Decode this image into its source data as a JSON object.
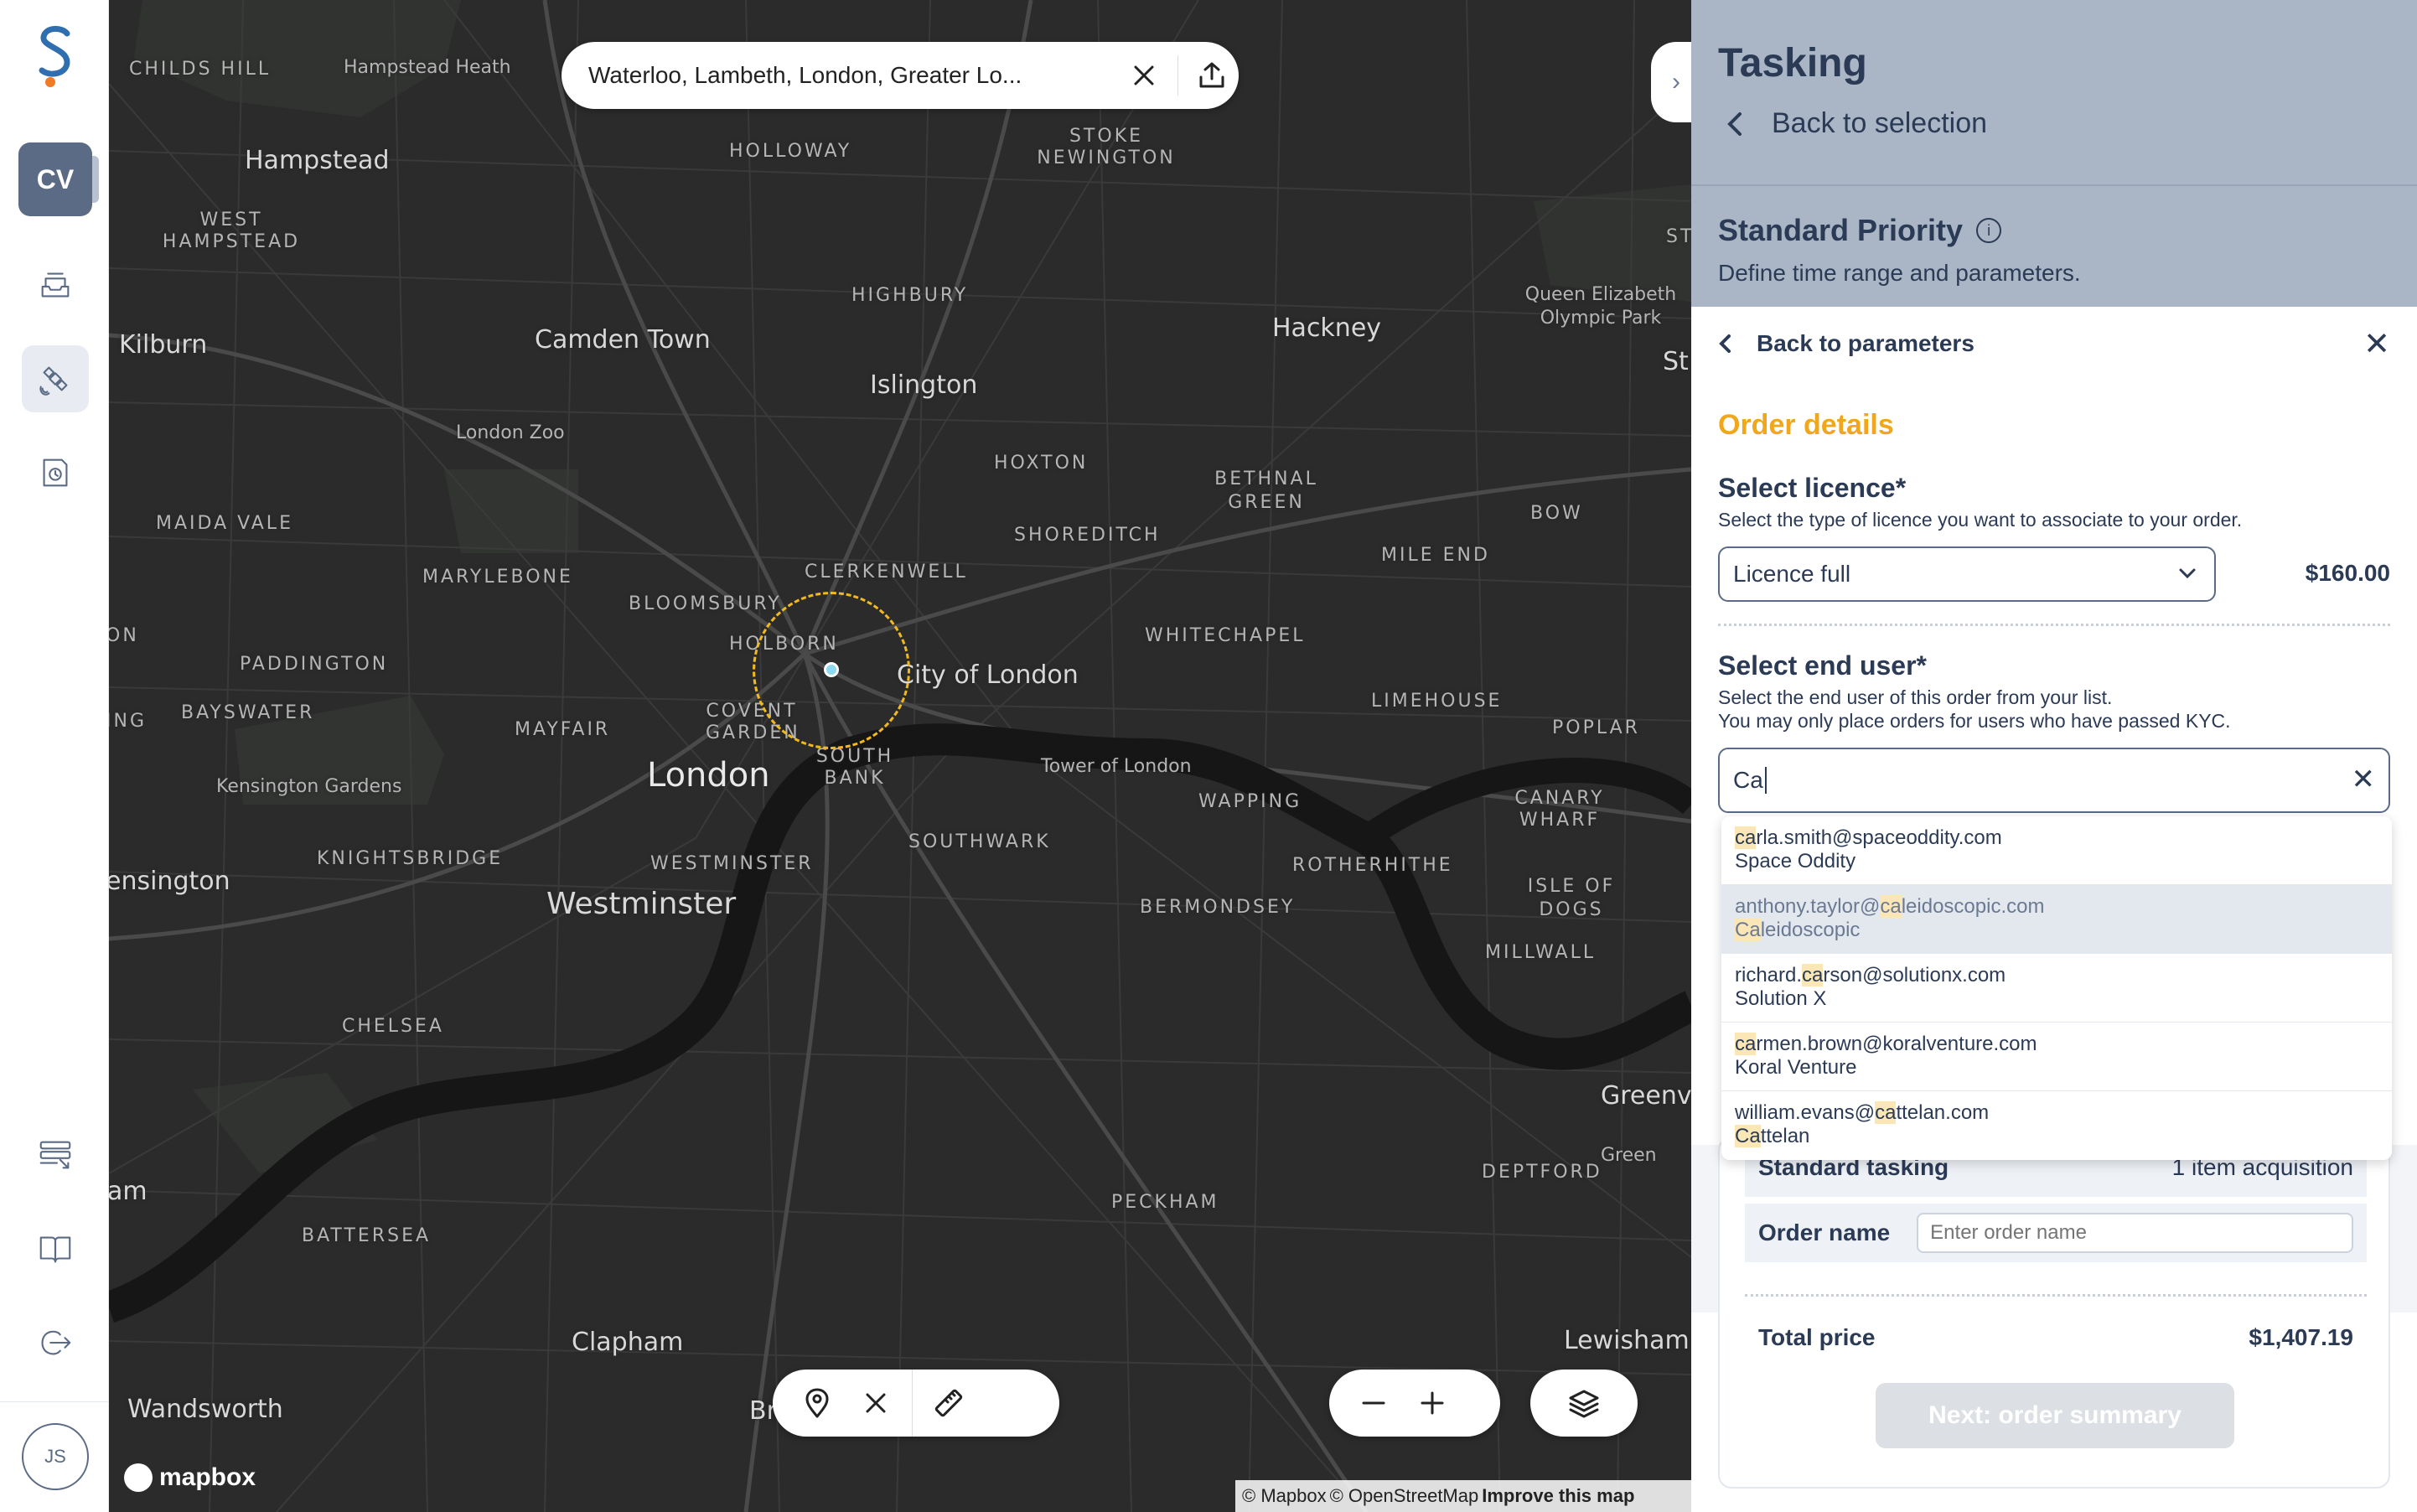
{
  "rail": {
    "avatar_initials": "CV",
    "user_initials": "JS",
    "icons": [
      "logo-icon",
      "inbox-icon",
      "satellite-icon",
      "orders-icon",
      "list-icon",
      "book-icon",
      "logout-icon"
    ]
  },
  "map": {
    "search_value": "Waterloo, Lambeth, London, Greater Lo...",
    "attribution": {
      "mapbox": "© Mapbox",
      "osm": "© OpenStreetMap",
      "improve": "Improve this map"
    },
    "logo_text": "mapbox",
    "places": {
      "childs_hill": "CHILDS HILL",
      "hampstead_heath": "Hampstead Heath",
      "hampstead": "Hampstead",
      "west_hampstead": "WEST HAMPSTEAD",
      "holloway": "HOLLOWAY",
      "stoke_newington": "STOKE NEWINGTON",
      "highbury": "HIGHBURY",
      "kilburn": "Kilburn",
      "camden_town": "Camden Town",
      "islington": "Islington",
      "hackney": "Hackney",
      "queen_elizabeth": "Queen Elizabeth Olympic Park",
      "london_zoo": "London Zoo",
      "maida_vale": "MAIDA VALE",
      "hoxton": "HOXTON",
      "bethnal_green": "BETHNAL GREEN",
      "bow": "BOW",
      "marylebone": "MARYLEBONE",
      "shoreditch": "SHOREDITCH",
      "mile_end": "MILE END",
      "clerkenwell": "CLERKENWELL",
      "bloomsbury": "BLOOMSBURY",
      "holborn": "HOLBORN",
      "paddington": "PADDINGTON",
      "city_of_london": "City of London",
      "whitechapel": "WHITECHAPEL",
      "bayswater": "BAYSWATER",
      "mayfair": "MAYFAIR",
      "covent_garden": "COVENT GARDEN",
      "limehouse": "LIMEHOUSE",
      "poplar": "POPLAR",
      "kensington_gardens": "Kensington Gardens",
      "london": "London",
      "south_bank": "SOUTH BANK",
      "tower_of_london": "Tower of London",
      "wapping": "WAPPING",
      "canary_wharf": "CANARY WHARF",
      "knightsbridge": "KNIGHTSBRIDGE",
      "westminster_area": "WESTMINSTER",
      "southwark": "SOUTHWARK",
      "rotherhithe": "ROTHERHITHE",
      "kensington": "ensington",
      "westminster": "Westminster",
      "bermondsey": "BERMONDSEY",
      "isle_of_dogs": "ISLE OF DOGS",
      "millwall": "MILLWALL",
      "chelsea": "CHELSEA",
      "battersea": "BATTERSEA",
      "peckham": "PECKHAM",
      "deptford": "DEPTFORD",
      "clapham": "Clapham",
      "lewisham": "Lewisham",
      "wandsworth": "Wandsworth",
      "brixton_partial": "Br",
      "greenwich_partial": "Greenv",
      "greenwich_small": "Green",
      "ham_partial": "am",
      "ing_partial": "ING",
      "on_partial": "ON",
      "st_partial": "St",
      "st_small": "ST"
    }
  },
  "panel": {
    "title": "Tasking",
    "back_to_selection": "Back to selection",
    "priority_title": "Standard Priority",
    "priority_subtitle": "Define time range and parameters.",
    "back_to_parameters": "Back to parameters",
    "order_details": "Order details",
    "licence_label": "Select licence*",
    "licence_help": "Select the type of licence you want to associate to your order.",
    "licence_value": "Licence full",
    "licence_price": "$160.00",
    "end_user_label": "Select end user*",
    "end_user_help_1": "Select the end user of this order from your list.",
    "end_user_help_2": "You may only place orders for users who have passed KYC.",
    "end_user_query": "Ca",
    "suggestions": [
      {
        "pre": "",
        "match": "ca",
        "post": "rla.smith@spaceoddity.com",
        "co_pre": "",
        "co_match": "",
        "co_post": "Space Oddity"
      },
      {
        "pre": "anthony.taylor@",
        "match": "ca",
        "post": "leidoscopic.com",
        "co_pre": "",
        "co_match": "Ca",
        "co_post": "leidoscopic"
      },
      {
        "pre": "richard.",
        "match": "ca",
        "post": "rson@solutionx.com",
        "co_pre": "",
        "co_match": "",
        "co_post": "Solution X"
      },
      {
        "pre": "",
        "match": "ca",
        "post": "rmen.brown@koralventure.com",
        "co_pre": "",
        "co_match": "",
        "co_post": "Koral Venture"
      },
      {
        "pre": "william.evans@",
        "match": "ca",
        "post": "ttelan.com",
        "co_pre": "",
        "co_match": "Ca",
        "co_post": "ttelan"
      }
    ],
    "summary": {
      "tasking_label": "Standard tasking",
      "tasking_value": "1 item acquisition",
      "order_name_label": "Order name",
      "order_name_placeholder": "Enter order name",
      "total_label": "Total price",
      "total_value": "$1,407.19",
      "next_button": "Next: order summary"
    }
  },
  "colors": {
    "accent": "#f1a71b",
    "panel_bg": "#aab6c6",
    "map_bg": "#2b2b2b",
    "aoi": "#f1b91e",
    "text": "#2b3a55"
  }
}
